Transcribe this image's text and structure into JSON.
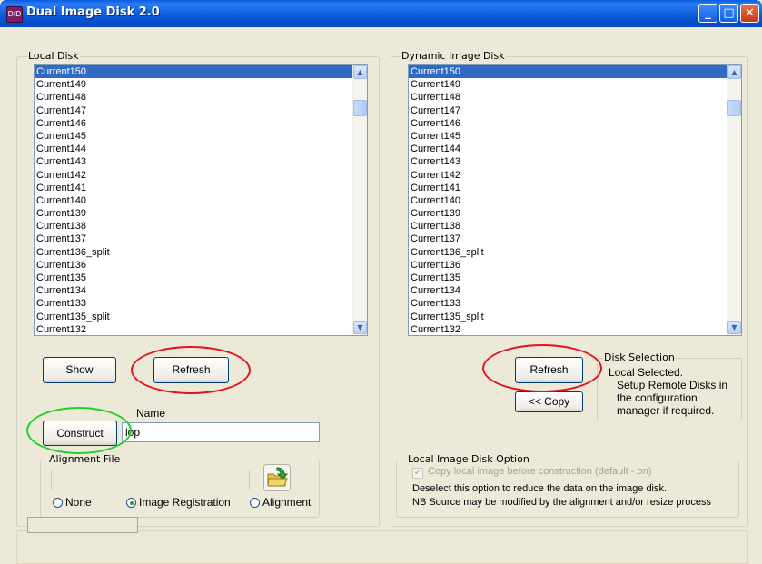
{
  "window": {
    "title": "Dual Image Disk 2.0",
    "icon_text": "DID",
    "minimize_glyph": "_",
    "maximize_glyph": "□",
    "close_glyph": "✕"
  },
  "local_disk": {
    "label": "Local Disk",
    "items": [
      "Current150",
      "Current149",
      "Current148",
      "Current147",
      "Current146",
      "Current145",
      "Current144",
      "Current143",
      "Current142",
      "Current141",
      "Current140",
      "Current139",
      "Current138",
      "Current137",
      "Current136_split",
      "Current136",
      "Current135",
      "Current134",
      "Current133",
      "Current135_split",
      "Current132"
    ],
    "selected_index": 0,
    "show_label": "Show",
    "refresh_label": "Refresh"
  },
  "dynamic_disk": {
    "label": "Dynamic Image Disk",
    "items": [
      "Current150",
      "Current149",
      "Current148",
      "Current147",
      "Current146",
      "Current145",
      "Current144",
      "Current143",
      "Current142",
      "Current141",
      "Current140",
      "Current139",
      "Current138",
      "Current137",
      "Current136_split",
      "Current136",
      "Current135",
      "Current134",
      "Current133",
      "Current135_split",
      "Current132"
    ],
    "selected_index": 0,
    "refresh_label": "Refresh",
    "copy_label": "<< Copy"
  },
  "disk_selection": {
    "label": "Disk Selection",
    "status": "Local Selected.",
    "help": "Setup Remote Disks in the configuration manager if required."
  },
  "construct": {
    "button_label": "Construct",
    "name_label": "Name",
    "name_value": "lop"
  },
  "alignment_file": {
    "label": "Alignment File",
    "path_value": "",
    "options": [
      "None",
      "Image Registration",
      "Alignment"
    ],
    "selected_option": "Image Registration"
  },
  "local_image_option": {
    "label": "Local Image Disk Option",
    "checkbox_label": "Copy local image before construction (default - on)",
    "checked": true,
    "note_line1": "Deselect this option to reduce the data on the image disk.",
    "note_line2": "NB Source may be modified by the alignment and/or resize process"
  },
  "status_bar": {
    "text": ""
  },
  "annotation_colors": {
    "red": "#e0141e",
    "green": "#22d22a"
  }
}
